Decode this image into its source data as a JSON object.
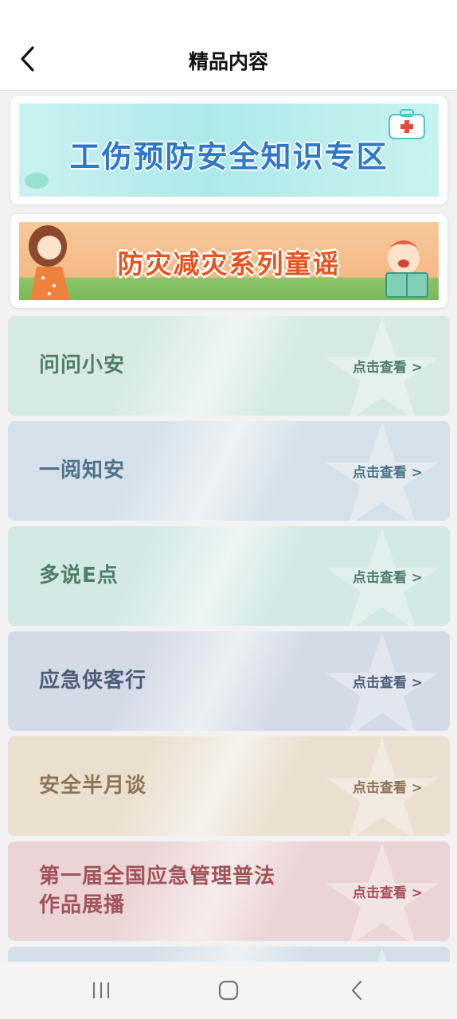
{
  "header": {
    "title": "精品内容"
  },
  "banners": [
    {
      "text": "工伤预防安全知识专区"
    },
    {
      "text": "防灾减灾系列童谣"
    }
  ],
  "items": [
    {
      "title": "问问小安",
      "link": "点击查看 >",
      "bg": "#d6eae3",
      "color": "#4f7d6a"
    },
    {
      "title": "一阅知安",
      "link": "点击查看 >",
      "bg": "#d4e1ea",
      "color": "#4f7288"
    },
    {
      "title": "多说E点",
      "link": "点击查看 >",
      "bg": "#d3e9e3",
      "color": "#4f7d6a"
    },
    {
      "title": "应急侠客行",
      "link": "点击查看 >",
      "bg": "#d3dbe7",
      "color": "#4f5d79"
    },
    {
      "title": "安全半月谈",
      "link": "点击查看 >",
      "bg": "#ebdfd0",
      "color": "#8d7556"
    },
    {
      "title": "第一届全国应急管理普法作品展播",
      "link": "点击查看 >",
      "bg": "#ebd4d6",
      "color": "#a2525a"
    },
    {
      "title": "",
      "link": "",
      "bg": "#d4e0e8",
      "color": "#4f7288"
    }
  ],
  "colors": {
    "header_bg": "#ffffff",
    "page_bg": "#f2f2f2"
  }
}
